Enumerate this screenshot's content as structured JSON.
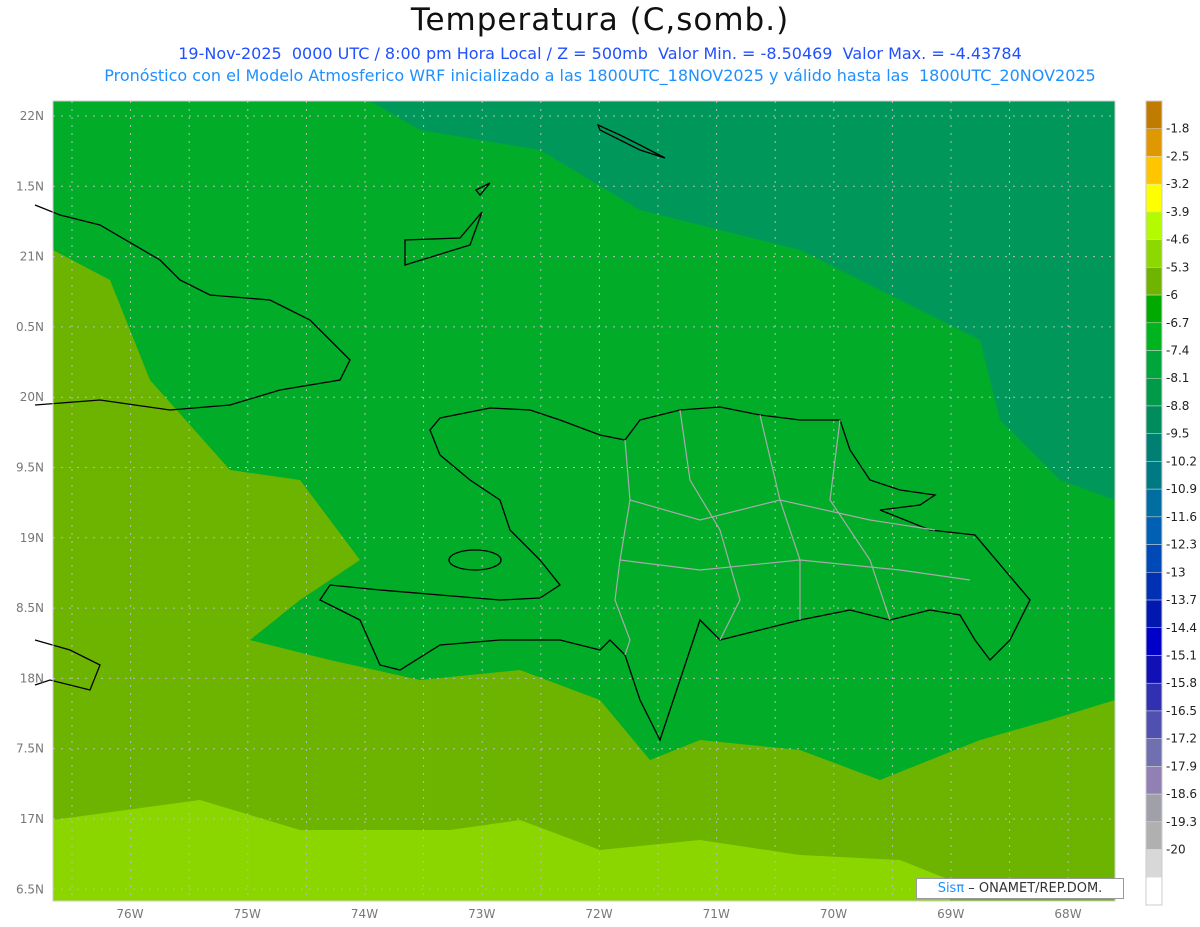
{
  "title": "Temperatura (C,somb.)",
  "subtitle_line1": "19-Nov-2025  0000 UTC / 8:00 pm Hora Local / Z = 500mb  Valor Min. = -8.50469  Valor Max. = -4.43784",
  "subtitle_line2": "Pronóstico con el Modelo Atmosferico WRF inicializado a las 1800UTC_18NOV2025 y válido hasta las  1800UTC_20NOV2025",
  "map": {
    "lon_labels": [
      "76W",
      "75W",
      "74W",
      "73W",
      "72W",
      "71W",
      "70W",
      "69W",
      "68W"
    ],
    "lat_labels": [
      "22N",
      "1.5N",
      "21N",
      "0.5N",
      "20N",
      "9.5N",
      "19N",
      "8.5N",
      "18N",
      "7.5N",
      "17N",
      "6.5N"
    ],
    "field_colors": {
      "northeast": "#00985a",
      "central": "#00ac28",
      "south": "#6cb400",
      "far_south": "#8cd600"
    }
  },
  "colorbar": {
    "labels": [
      "-1.8",
      "-2.5",
      "-3.2",
      "-3.9",
      "-4.6",
      "-5.3",
      "-6",
      "-6.7",
      "-7.4",
      "-8.1",
      "-8.8",
      "-9.5",
      "-10.2",
      "-10.9",
      "-11.6",
      "-12.3",
      "-13",
      "-13.7",
      "-14.4",
      "-15.1",
      "-15.8",
      "-16.5",
      "-17.2",
      "-17.9",
      "-18.6",
      "-19.3",
      "-20"
    ],
    "colors": [
      "#bf7c00",
      "#e09800",
      "#ffc600",
      "#ffff00",
      "#b4fa00",
      "#8cd800",
      "#6eb400",
      "#00aa00",
      "#00b420",
      "#00a63c",
      "#009a48",
      "#008c5c",
      "#007f72",
      "#007a82",
      "#006ea0",
      "#0060b4",
      "#004ab8",
      "#0030b4",
      "#0018b0",
      "#0000c8",
      "#1010b4",
      "#3030b0",
      "#5050b0",
      "#7070b0",
      "#9080b4",
      "#a0a0a8",
      "#b0b0b0",
      "#d8d8d8",
      "#ffffff"
    ]
  },
  "credit": {
    "brand": "Sisπ",
    "text": " – ONAMET/REP.DOM."
  }
}
